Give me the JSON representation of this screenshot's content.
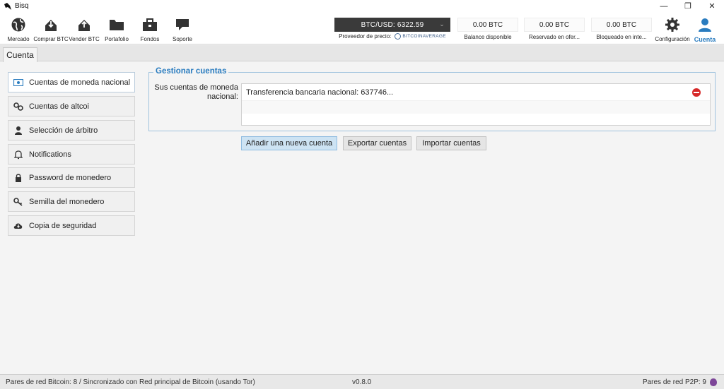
{
  "window": {
    "title": "Bisq",
    "controls": [
      "—",
      "❐",
      "✕"
    ]
  },
  "nav": [
    {
      "label": "Mercado",
      "icon": "market-globe-icon"
    },
    {
      "label": "Comprar BTC",
      "icon": "buy-btc-icon"
    },
    {
      "label": "Vender BTC",
      "icon": "sell-btc-icon"
    },
    {
      "label": "Portafolio",
      "icon": "portfolio-folder-icon"
    },
    {
      "label": "Fondos",
      "icon": "funds-briefcase-icon"
    },
    {
      "label": "Soporte",
      "icon": "support-chat-icon"
    }
  ],
  "price": {
    "value": "BTC/USD: 6322.59",
    "provider_label": "Proveedor de precio:",
    "provider_name": "BitcoinAverage"
  },
  "balances": [
    {
      "value": "0.00 BTC",
      "caption": "Balance disponible"
    },
    {
      "value": "0.00 BTC",
      "caption": "Reservado en ofer..."
    },
    {
      "value": "0.00 BTC",
      "caption": "Bloqueado en inte..."
    }
  ],
  "settings_label": "Configuración",
  "account_label": "Cuenta",
  "accent": "#2a7cbf",
  "tab": {
    "label": "Cuenta"
  },
  "sidebar": {
    "items": [
      {
        "label": "Cuentas de moneda nacional",
        "icon": "bank-note-icon",
        "active": true
      },
      {
        "label": "Cuentas de altcoi",
        "icon": "link-icon",
        "active": false
      },
      {
        "label": "Selección de árbitro",
        "icon": "arbitrator-icon",
        "active": false
      },
      {
        "label": "Notifications",
        "icon": "bell-icon",
        "active": false
      },
      {
        "label": "Password de monedero",
        "icon": "lock-icon",
        "active": false
      },
      {
        "label": "Semilla del monedero",
        "icon": "key-icon",
        "active": false
      },
      {
        "label": "Copia de seguridad",
        "icon": "cloud-download-icon",
        "active": false
      }
    ]
  },
  "main": {
    "group_title": "Gestionar cuentas",
    "accounts_label_line1": "Sus cuentas de moneda",
    "accounts_label_line2": "nacional:",
    "accounts": [
      "Transferencia bancaria nacional: 637746..."
    ],
    "buttons": {
      "add": "Añadir una nueva cuenta",
      "export": "Exportar cuentas",
      "import": "Importar cuentas"
    }
  },
  "status": {
    "left": "Pares de red Bitcoin: 8 / Sincronizado con Red principal de Bitcoin (usando Tor)",
    "version": "v0.8.0",
    "right": "Pares de red P2P: 9"
  }
}
